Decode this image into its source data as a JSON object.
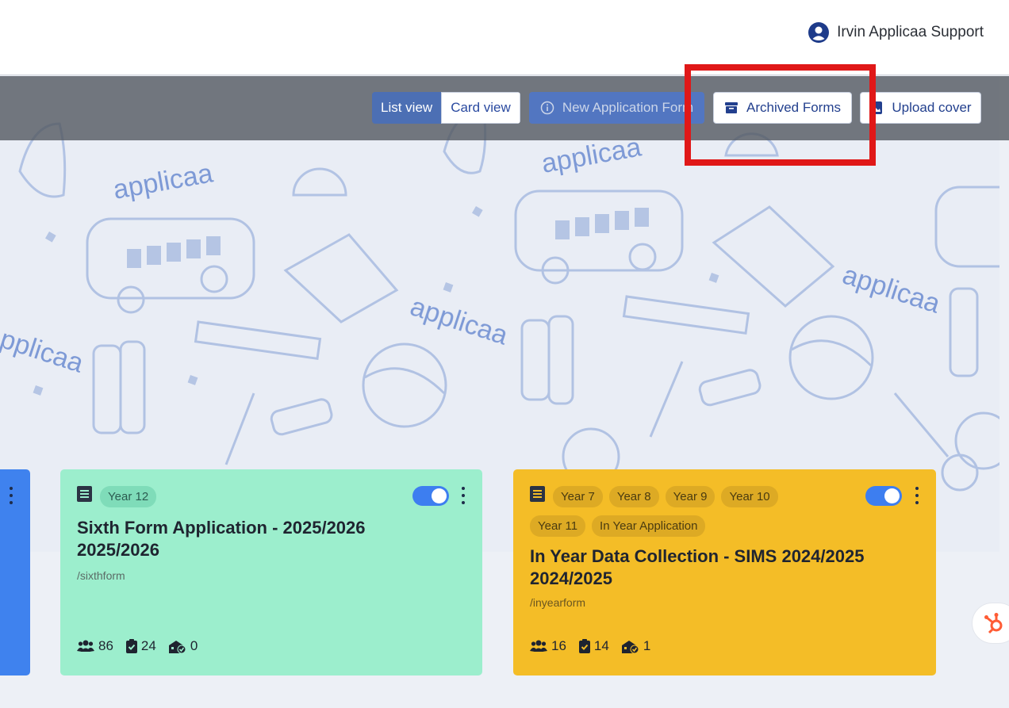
{
  "header": {
    "user_name": "Irvin Applicaa Support"
  },
  "toolbar": {
    "list_view": "List view",
    "card_view": "Card view",
    "new_form": "New Application Form",
    "archived_forms": "Archived Forms",
    "upload_cover": "Upload cover"
  },
  "cover": {
    "brand_text": "applicaa"
  },
  "cards": [
    {
      "tags": [
        "Year 12"
      ],
      "title": "Sixth Form Application - 2025/2026 2025/2026",
      "path": "/sixthform",
      "applicants": "86",
      "submitted": "24",
      "offers": "0",
      "enabled": true,
      "color": "#9ceecd"
    },
    {
      "tags": [
        "Year 7",
        "Year 8",
        "Year 9",
        "Year 10",
        "Year 11",
        "In Year Application"
      ],
      "title": "In Year Data Collection - SIMS 2024/2025 2024/2025",
      "path": "/inyearform",
      "applicants": "16",
      "submitted": "14",
      "offers": "1",
      "enabled": true,
      "color": "#f4bd27"
    }
  ],
  "colors": {
    "accent": "#3d7ef0",
    "highlight": "#e01818"
  }
}
